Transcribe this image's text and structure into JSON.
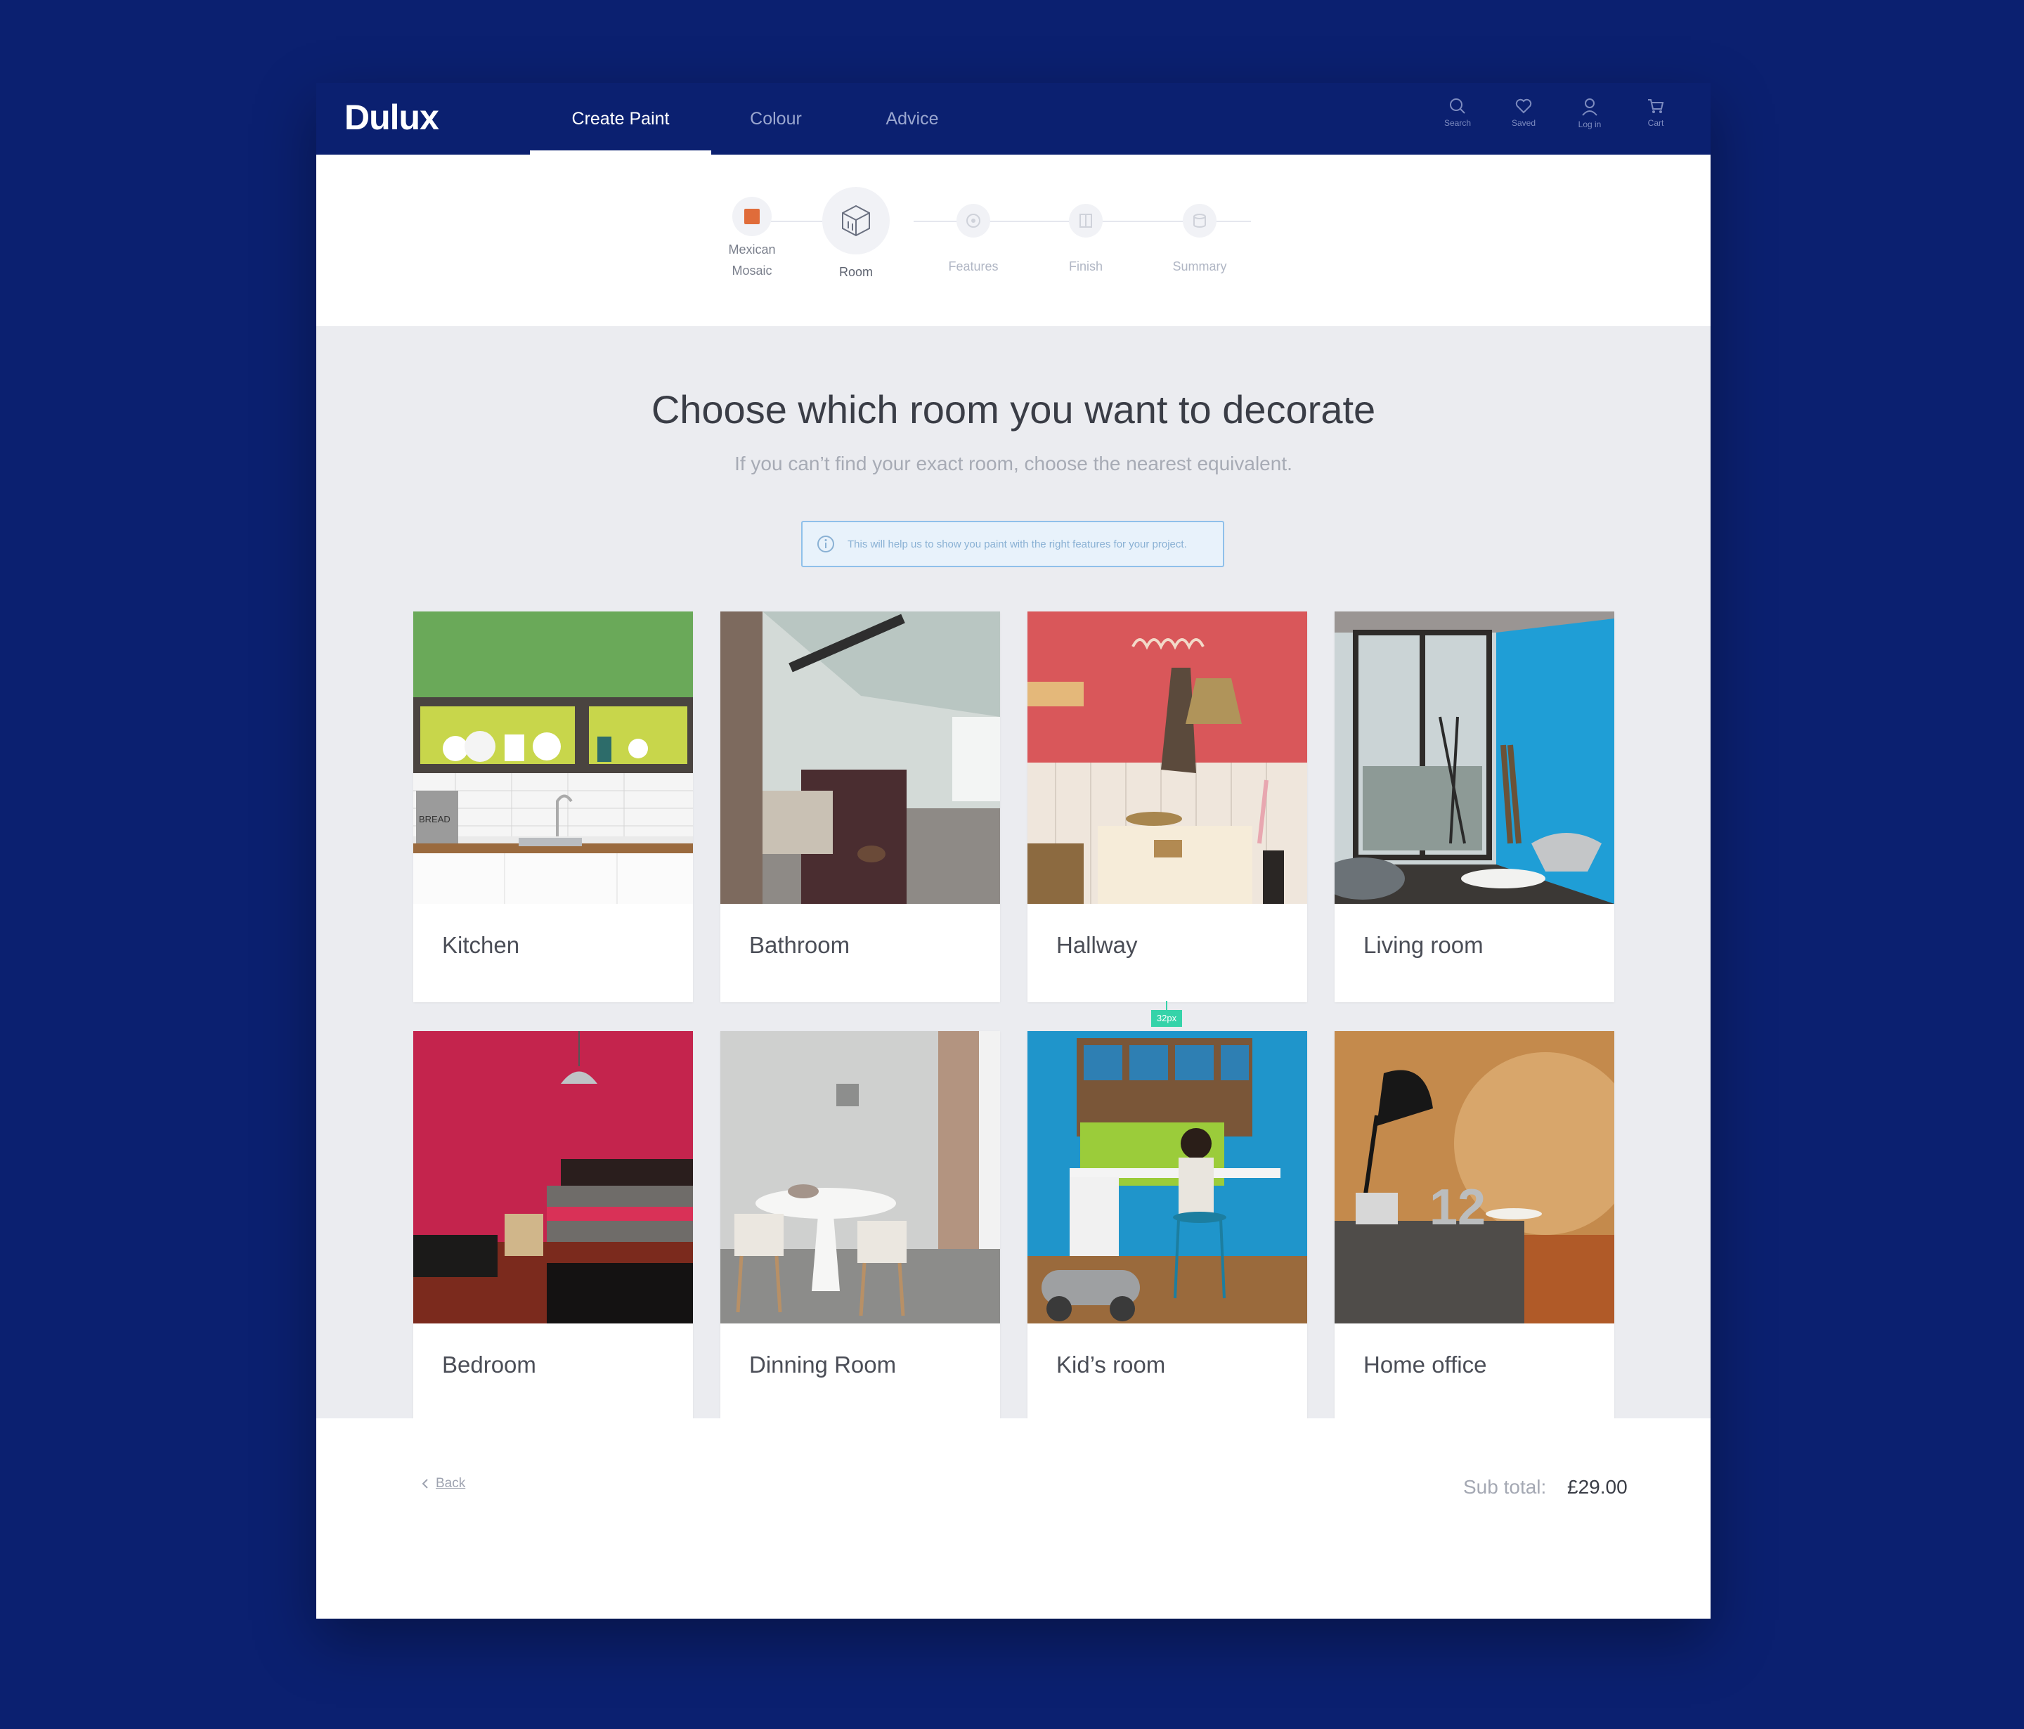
{
  "brand": {
    "logo": "Dulux",
    "colors": {
      "navy": "#0b2070",
      "swatch": "#e06c3a",
      "highlight": "#35d3a9"
    }
  },
  "nav": {
    "tabs": [
      {
        "label": "Create Paint",
        "active": true
      },
      {
        "label": "Colour"
      },
      {
        "label": "Advice"
      }
    ]
  },
  "header_icons": [
    {
      "icon": "search-icon",
      "label": "Search"
    },
    {
      "icon": "heart-icon",
      "label": "Saved"
    },
    {
      "icon": "user-icon",
      "label": "Log in"
    },
    {
      "icon": "cart-icon",
      "label": "Cart"
    }
  ],
  "stepper": {
    "steps": [
      {
        "label_line1": "Mexican",
        "label_line2": "Mosaic",
        "state": "done"
      },
      {
        "label": "Room",
        "state": "current"
      },
      {
        "label": "Features",
        "state": "upcoming"
      },
      {
        "label": "Finish",
        "state": "upcoming"
      },
      {
        "label": "Summary",
        "state": "upcoming"
      }
    ]
  },
  "main": {
    "title": "Choose which room you want to decorate",
    "subtitle": "If you can’t find your exact room, choose the nearest equivalent.",
    "info": "This will help us to show you paint with the right features for your project.",
    "spacing_tag": "32px",
    "rooms": [
      {
        "label": "Kitchen"
      },
      {
        "label": "Bathroom"
      },
      {
        "label": "Hallway"
      },
      {
        "label": "Living room"
      },
      {
        "label": "Bedroom"
      },
      {
        "label": "Dinning Room"
      },
      {
        "label": "Kid’s room"
      },
      {
        "label": "Home office"
      }
    ]
  },
  "footer": {
    "back": "Back",
    "subtotal_label": "Sub total:",
    "subtotal_value": "£29.00"
  }
}
